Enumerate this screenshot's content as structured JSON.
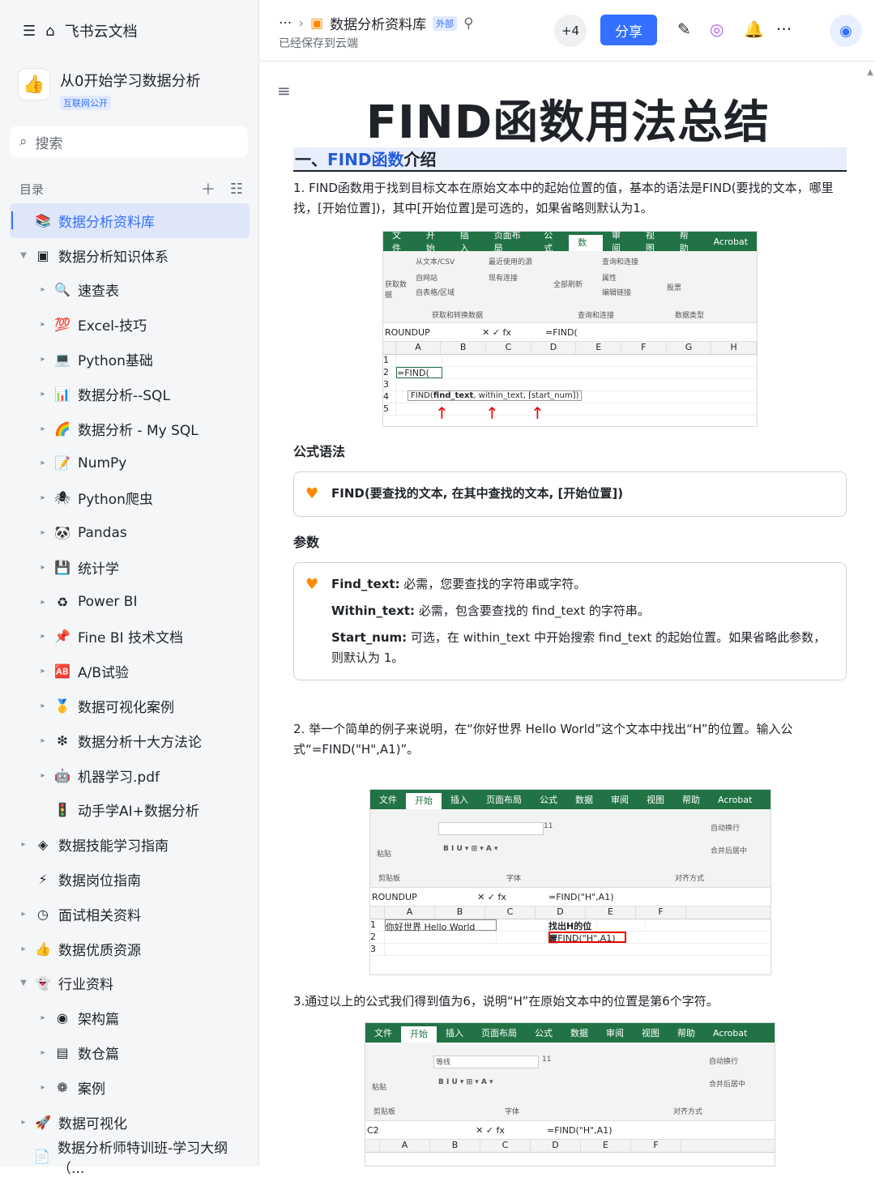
{
  "sidebar": {
    "home_title": "飞书云文档",
    "workspace_name": "从0开始学习数据分析",
    "workspace_tag": "互联网公开",
    "search_placeholder": "搜索",
    "toc_label": "目录",
    "items": [
      {
        "label": "数据分析资料库",
        "icon": "📚",
        "arrow": "",
        "level": 1,
        "selected": true
      },
      {
        "label": "数据分析知识体系",
        "icon": "▣",
        "arrow": "▼",
        "level": 1
      },
      {
        "label": "速查表",
        "icon": "🔍",
        "arrow": "▸",
        "level": 2
      },
      {
        "label": "Excel-技巧",
        "icon": "💯",
        "arrow": "▸",
        "level": 2
      },
      {
        "label": "Python基础",
        "icon": "💻",
        "arrow": "▸",
        "level": 2
      },
      {
        "label": "数据分析--SQL",
        "icon": "📊",
        "arrow": "▸",
        "level": 2
      },
      {
        "label": "数据分析 - My SQL",
        "icon": "🌈",
        "arrow": "▸",
        "level": 2
      },
      {
        "label": "NumPy",
        "icon": "📝",
        "arrow": "▸",
        "level": 2
      },
      {
        "label": "Python爬虫",
        "icon": "🕷",
        "arrow": "▸",
        "level": 2
      },
      {
        "label": "Pandas",
        "icon": "🐼",
        "arrow": "▸",
        "level": 2
      },
      {
        "label": "统计学",
        "icon": "💾",
        "arrow": "▸",
        "level": 2
      },
      {
        "label": "Power BI",
        "icon": "♻",
        "arrow": "▸",
        "level": 2
      },
      {
        "label": "Fine BI 技术文档",
        "icon": "📌",
        "arrow": "▸",
        "level": 2
      },
      {
        "label": "A/B试验",
        "icon": "🆎",
        "arrow": "▸",
        "level": 2
      },
      {
        "label": "数据可视化案例",
        "icon": "🥇",
        "arrow": "▸",
        "level": 2
      },
      {
        "label": "数据分析十大方法论",
        "icon": "❇",
        "arrow": "▸",
        "level": 2
      },
      {
        "label": "机器学习.pdf",
        "icon": "🤖",
        "arrow": "▸",
        "level": 2
      },
      {
        "label": "动手学AI+数据分析",
        "icon": "🚦",
        "arrow": "",
        "level": 2
      },
      {
        "label": "数据技能学习指南",
        "icon": "◈",
        "arrow": "▸",
        "level": 1
      },
      {
        "label": "数据岗位指南",
        "icon": "⚡",
        "arrow": "",
        "level": 1
      },
      {
        "label": "面试相关资料",
        "icon": "◷",
        "arrow": "▸",
        "level": 1
      },
      {
        "label": "数据优质资源",
        "icon": "👍",
        "arrow": "▸",
        "level": 1
      },
      {
        "label": "行业资料",
        "icon": "👻",
        "arrow": "▼",
        "level": 1
      },
      {
        "label": "架构篇",
        "icon": "◉",
        "arrow": "▸",
        "level": 2
      },
      {
        "label": "数仓篇",
        "icon": "▤",
        "arrow": "▸",
        "level": 2
      },
      {
        "label": "案例",
        "icon": "❁",
        "arrow": "▸",
        "level": 2
      },
      {
        "label": "数据可视化",
        "icon": "🚀",
        "arrow": "▸",
        "level": 1
      },
      {
        "label": "数据分析师特训班-学习大纲（...",
        "icon": "📄",
        "arrow": "",
        "level": 1
      }
    ]
  },
  "header": {
    "breadcrumb_title": "数据分析资料库",
    "external_tag": "外部",
    "saved_status": "已经保存到云端",
    "collaborators": "+4",
    "share_label": "分享"
  },
  "doc": {
    "title": "FIND函数用法总结",
    "section1_prefix": "一、",
    "section1_blue": "FIND函数",
    "section1_rest": "介绍",
    "para1": "1. FIND函数用于找到目标文本在原始文本中的起始位置的值，基本的语法是FIND(要找的文本，哪里找，[开始位置])，其中[开始位置]是可选的，如果省略则默认为1。",
    "syntax_heading": "公式语法",
    "syntax": "FIND(要查找的文本, 在其中查找的文本, [开始位置])",
    "params_heading": "参数",
    "params": [
      {
        "name": "Find_text:",
        "desc": " 必需，您要查找的字符串或字符。"
      },
      {
        "name": "Within_text:",
        "desc": " 必需，包含要查找的 find_text 的字符串。"
      },
      {
        "name": "Start_num:",
        "desc": " 可选，在 within_text 中开始搜索 find_text 的起始位置。如果省略此参数，则默认为 1。"
      }
    ],
    "para2": "2. 举一个简单的例子来说明，在“你好世界 Hello World”这个文本中找出“H”的位置。输入公式“=FIND(\"H\",A1)”。",
    "para3": "3.通过以上的公式我们得到值为6，说明“H”在原始文本中的位置是第6个字符。"
  },
  "excel1": {
    "tabs": [
      "文件",
      "开始",
      "插入",
      "页面布局",
      "公式",
      "数据",
      "审阅",
      "视图",
      "帮助",
      "Acrobat"
    ],
    "active_tab": "数据",
    "ribbon_items": [
      "从文本/CSV",
      "最近使用的源",
      "自网站",
      "现有连接",
      "自表格/区域",
      "获取数据",
      "全部刷新",
      "查询和连接",
      "属性",
      "编辑链接",
      "股票"
    ],
    "groups": [
      "获取和转换数据",
      "查询和连接",
      "数据类型"
    ],
    "namebox": "ROUNDUP",
    "formula": "=FIND(",
    "columns": [
      "A",
      "B",
      "C",
      "D",
      "E",
      "F",
      "G",
      "H"
    ],
    "rows": [
      "1",
      "2",
      "3",
      "4",
      "5"
    ],
    "cell_a2": "=FIND(",
    "tooltip_fn": "FIND(",
    "tooltip_arg1": "find_text",
    "tooltip_rest": ", within_text, [start_num])"
  },
  "excel2": {
    "tabs": [
      "文件",
      "开始",
      "插入",
      "页面布局",
      "公式",
      "数据",
      "审阅",
      "视图",
      "帮助",
      "Acrobat"
    ],
    "active_tab": "开始",
    "ribbon_items": [
      "粘贴",
      "11",
      "自动换行",
      "合并后居中"
    ],
    "groups": [
      "剪贴板",
      "字体",
      "对齐方式"
    ],
    "namebox": "ROUNDUP",
    "formula": "=FIND(\"H\",A1)",
    "columns": [
      "A",
      "B",
      "C",
      "D",
      "E",
      "F"
    ],
    "rows": [
      "1",
      "2",
      "3"
    ],
    "cell_a1": "你好世界 Hello World",
    "cell_c1": "找出H的位置",
    "cell_c2": "=FIND(\"H\",A1)"
  },
  "excel3": {
    "tabs": [
      "文件",
      "开始",
      "插入",
      "页面布局",
      "公式",
      "数据",
      "审阅",
      "视图",
      "帮助",
      "Acrobat"
    ],
    "active_tab": "开始",
    "ribbon_items": [
      "粘贴",
      "等线",
      "11",
      "自动换行",
      "合并后居中"
    ],
    "groups": [
      "剪贴板",
      "字体",
      "对齐方式"
    ],
    "namebox": "C2",
    "formula": "=FIND(\"H\",A1)",
    "columns": [
      "A",
      "B",
      "C",
      "D",
      "E",
      "F"
    ]
  }
}
